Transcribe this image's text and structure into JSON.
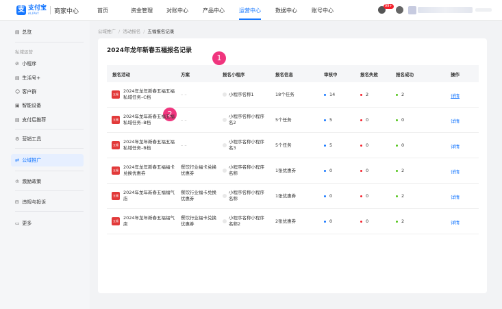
{
  "header": {
    "logo_mark": "支",
    "logo_cn": "支付宝",
    "logo_en": "ALIPAY",
    "logo_sub": "商家中心",
    "nav": [
      "首页",
      "资金管理",
      "对账中心",
      "产品中心",
      "运营中心",
      "数据中心",
      "账号中心"
    ],
    "active_nav": "运营中心",
    "badge": "99+"
  },
  "sidebar": {
    "top_item": "总览",
    "group_label": "私域运营",
    "items": [
      "小程序",
      "生活号+",
      "客户群",
      "智能设备",
      "支付后推荐"
    ],
    "marketing": "营销工具",
    "public_promo": "公域推广",
    "policy": "激励政策",
    "complaints": "违规与投诉",
    "more": "更多"
  },
  "breadcrumb": [
    "公域推广",
    "活动报名",
    "五福报名记录"
  ],
  "page_title": "2024年龙年新春五福报名记录",
  "markers": [
    "1",
    "2"
  ],
  "table": {
    "headers": [
      "报名活动",
      "方案",
      "报名小程序",
      "报名信息",
      "审核中",
      "报名失败",
      "报名成功",
      "操作"
    ],
    "rows": [
      {
        "activity": "2024年龙年新春五福五福私域任务–C档",
        "plan": "– –",
        "mini": "小程序名称1",
        "info": "18个任务",
        "review": "14",
        "fail": "2",
        "success": "2",
        "op": "详情"
      },
      {
        "activity": "2024年龙年新春五福五福私域任务–B档",
        "plan": "– –",
        "mini": "小程序名称小程序名2",
        "info": "5个任务",
        "review": "5",
        "fail": "0",
        "success": "0",
        "op": "详情"
      },
      {
        "activity": "2024年龙年新春五福五福私域任务–B档",
        "plan": "– –",
        "mini": "小程序名称小程序名3",
        "info": "5个任务",
        "review": "5",
        "fail": "0",
        "success": "0",
        "op": "详情"
      },
      {
        "activity": "2024年龙年新春五福福卡兑换优惠券",
        "plan": "餐饮行业福卡兑换优惠券",
        "mini": "小程序名称小程序名称",
        "info": "1张优惠券",
        "review": "0",
        "fail": "0",
        "success": "2",
        "op": "详情"
      },
      {
        "activity": "2024年龙年新春五福福气店",
        "plan": "餐饮行业福卡兑换优惠券",
        "mini": "小程序名称小程序名称",
        "info": "1张优惠券",
        "review": "0",
        "fail": "0",
        "success": "2",
        "op": "详情"
      },
      {
        "activity": "2024年龙年新春五福福气店",
        "plan": "餐饮行业福卡兑换优惠券",
        "mini": "小程序名称小程序名称2",
        "info": "2张优惠券",
        "review": "0",
        "fail": "0",
        "success": "2",
        "op": "详情"
      }
    ]
  },
  "colors": {
    "accent": "#1677ff",
    "marker": "#f0357e",
    "fail": "#f5222d",
    "success": "#52c41a"
  }
}
